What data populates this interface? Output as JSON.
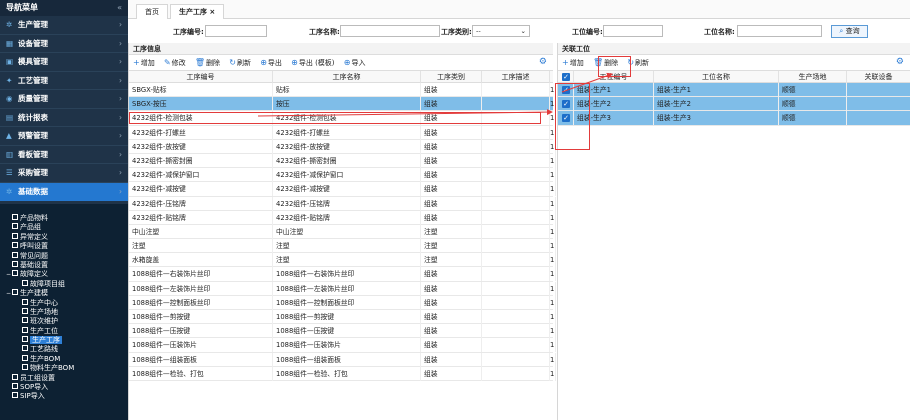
{
  "sidebar": {
    "title": "导航菜单",
    "collapse": "«",
    "menus": [
      {
        "label": "生产管理",
        "icon": "gear-icon",
        "glyph": "✲"
      },
      {
        "label": "设备管理",
        "icon": "device-icon",
        "glyph": "▦"
      },
      {
        "label": "模具管理",
        "icon": "mold-icon",
        "glyph": "▣"
      },
      {
        "label": "工艺管理",
        "icon": "process-icon",
        "glyph": "✦"
      },
      {
        "label": "质量管理",
        "icon": "quality-icon",
        "glyph": "◉"
      },
      {
        "label": "统计报表",
        "icon": "report-icon",
        "glyph": "▤"
      },
      {
        "label": "预警管理",
        "icon": "warning-icon",
        "glyph": "▲"
      },
      {
        "label": "看板管理",
        "icon": "board-icon",
        "glyph": "▥"
      },
      {
        "label": "采购管理",
        "icon": "cart-icon",
        "glyph": "☰"
      },
      {
        "label": "基础数据",
        "icon": "data-icon",
        "glyph": "✲"
      }
    ],
    "tree": [
      {
        "label": "产品物料",
        "lvl": 1
      },
      {
        "label": "产品组",
        "lvl": 1
      },
      {
        "label": "异常定义",
        "lvl": 1
      },
      {
        "label": "呼叫设置",
        "lvl": 1
      },
      {
        "label": "常见问题",
        "lvl": 1
      },
      {
        "label": "基础设置",
        "lvl": 1
      },
      {
        "label": "故障定义",
        "lvl": 0,
        "toggle": "−"
      },
      {
        "label": "故障项目组",
        "lvl": 2
      },
      {
        "label": "生产建模",
        "lvl": 0,
        "toggle": "−"
      },
      {
        "label": "生产中心",
        "lvl": 2
      },
      {
        "label": "生产场地",
        "lvl": 2
      },
      {
        "label": "班次维护",
        "lvl": 2
      },
      {
        "label": "生产工位",
        "lvl": 2
      },
      {
        "label": "生产工序",
        "lvl": 2,
        "sel": true
      },
      {
        "label": "工艺路线",
        "lvl": 2
      },
      {
        "label": "生产BOM",
        "lvl": 2
      },
      {
        "label": "物料生产BOM",
        "lvl": 2
      },
      {
        "label": "员工组设置",
        "lvl": 1
      },
      {
        "label": "SOP导入",
        "lvl": 1
      },
      {
        "label": "SIP导入",
        "lvl": 1
      }
    ]
  },
  "tabs": [
    {
      "label": "首页"
    },
    {
      "label": "生产工序 ×"
    }
  ],
  "search": {
    "code_label": "工序编号:",
    "name_label": "工序名称:",
    "type_label": "工序类别:",
    "type_value": "--",
    "station_code_label": "工位编号:",
    "station_name_label": "工位名称:",
    "query": "查询"
  },
  "left": {
    "title": "工序信息",
    "toolbar": {
      "add": "增加",
      "edit": "修改",
      "del": "删除",
      "refresh": "刷新",
      "export": "导出",
      "export_tpl": "导出 (模板)",
      "import": "导入"
    },
    "cols": [
      "工序编号",
      "工序名称",
      "工序类别",
      "工序描述"
    ],
    "rows": [
      [
        "SBGX-贴标",
        "贴标",
        "组装",
        ""
      ],
      [
        "SBGX-按压",
        "按压",
        "组装",
        ""
      ],
      [
        "4232组件-检测包装",
        "4232组件-检测包装",
        "组装",
        ""
      ],
      [
        "4232组件-打螺丝",
        "4232组件-打螺丝",
        "组装",
        ""
      ],
      [
        "4232组件-放按键",
        "4232组件-放按键",
        "组装",
        ""
      ],
      [
        "4232组件-撕密封圈",
        "4232组件-撕密封圈",
        "组装",
        ""
      ],
      [
        "4232组件-减保护窗口",
        "4232组件-减保护窗口",
        "组装",
        ""
      ],
      [
        "4232组件-减按键",
        "4232组件-减按键",
        "组装",
        ""
      ],
      [
        "4232组件-压铭牌",
        "4232组件-压铭牌",
        "组装",
        ""
      ],
      [
        "4232组件-贴铭牌",
        "4232组件-贴铭牌",
        "组装",
        ""
      ],
      [
        "中山注塑",
        "中山注塑",
        "注塑",
        ""
      ],
      [
        "注塑",
        "注塑",
        "注塑",
        ""
      ],
      [
        "水箱旋盖",
        "注塑",
        "注塑",
        ""
      ],
      [
        "1088组件—右装饰片丝印",
        "1088组件—右装饰片丝印",
        "组装",
        ""
      ],
      [
        "1088组件—左装饰片丝印",
        "1088组件—左装饰片丝印",
        "组装",
        ""
      ],
      [
        "1088组件—控制面板丝印",
        "1088组件—控制面板丝印",
        "组装",
        ""
      ],
      [
        "1088组件—剪按键",
        "1088组件—剪按键",
        "组装",
        ""
      ],
      [
        "1088组件—压按键",
        "1088组件—压按键",
        "组装",
        ""
      ],
      [
        "1088组件—压装饰片",
        "1088组件—压装饰片",
        "组装",
        ""
      ],
      [
        "1088组件—组装面板",
        "1088组件—组装面板",
        "组装",
        ""
      ],
      [
        "1088组件—检验、打包",
        "1088组件—检验、打包",
        "组装",
        ""
      ]
    ],
    "edge": "1"
  },
  "right": {
    "title": "关联工位",
    "toolbar": {
      "add": "增加",
      "del": "删除",
      "refresh": "刷新"
    },
    "cols": [
      "工位编号",
      "工位名称",
      "生产场地",
      "关联设备"
    ],
    "rows": [
      [
        "组装-生产1",
        "组装-生产1",
        "顺德",
        ""
      ],
      [
        "组装-生产2",
        "组装-生产2",
        "顺德",
        ""
      ],
      [
        "组装-生产3",
        "组装-生产3",
        "顺德",
        ""
      ]
    ]
  },
  "colors": {
    "selection": "#7fbde8",
    "annotation": "#e23b3b",
    "accent": "#2478d0"
  }
}
